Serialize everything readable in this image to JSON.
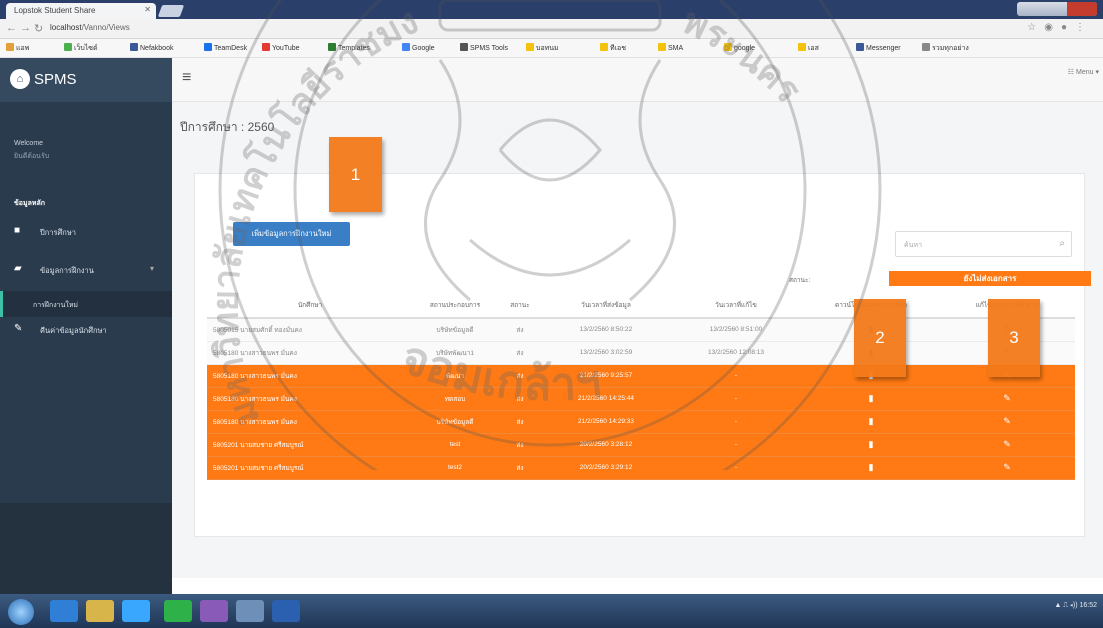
{
  "browser": {
    "tab_title": "Lopstok Student Share",
    "url_host": "localhost",
    "url_path": "/Vanno/Views",
    "bookmarks": [
      "แอพ",
      "เว็บไซต์",
      "Nefakbook",
      "TeamDesk",
      "YouTube",
      "Templates",
      "Google",
      "SPMS Tools",
      "บอทนม",
      "ทีเอช",
      "SMA",
      "google",
      "เอส",
      "Messenger",
      "รวมทุกอย่าง"
    ]
  },
  "sidebar": {
    "brand": "SPMS",
    "welcome": "Welcome",
    "welcome_user": "ยินดีต้อนรับ",
    "heading": "ข้อมูลหลัก",
    "items": [
      {
        "label": "ปีการศึกษา",
        "icon": "bookmark-icon"
      },
      {
        "label": "ข้อมูลการฝึกงาน",
        "icon": "folder-icon"
      },
      {
        "label": "การฝึกงานใหม่",
        "icon": "sub-item"
      },
      {
        "label": "คืนค่าข้อมูลนักศึกษา",
        "icon": "edit-icon"
      }
    ]
  },
  "header": {
    "menu": "Menu"
  },
  "main": {
    "year_label": "ปีการศึกษา : 2560",
    "add_button": "เพิ่มข้อมูลการฝึกงานใหม่",
    "search_placeholder": "ค้นหา",
    "legend_label": "สถานะ:",
    "legend_status": "ยังไม่ส่งเอกสาร",
    "columns": [
      "นักศึกษา",
      "สถานประกอบการ",
      "สถานะ",
      "วันเวลาที่ส่งข้อมูล",
      "วันเวลาที่แก้ไข",
      "ดาวน์โหลดเอกสารการฝึก",
      "แก้ไขข้อมูลการฝึกงาน"
    ],
    "rows": [
      {
        "student": "5805015 นายสมศักดิ์ ทองมั่นคง",
        "company": "บริษัทข้อมูลดี",
        "status": "ส่ง",
        "submitted": "13/2/2560 8:50:22",
        "edited": "13/2/2560 8:51:00",
        "highlight": false
      },
      {
        "student": "5805180 นางสาวธนพร มั่นคง",
        "company": "บริษัทพัฒนา1",
        "status": "ส่ง",
        "submitted": "13/2/2560 3:02:59",
        "edited": "13/2/2560 12:08:13",
        "highlight": false
      },
      {
        "student": "5805180 นางสาวธนพร มั่นคง",
        "company": "พัฒนา",
        "status": "ส่ง",
        "submitted": "21/2/2560 9:25:57",
        "edited": "-",
        "highlight": true
      },
      {
        "student": "5805180 นางสาวธนพร มั่นคง",
        "company": "ทดสอบ",
        "status": "ส่ง",
        "submitted": "21/2/2560 14:25:44",
        "edited": "-",
        "highlight": true
      },
      {
        "student": "5805180 นางสาวธนพร มั่นคง",
        "company": "บริษัทข้อมูลดี",
        "status": "ส่ง",
        "submitted": "21/2/2560 14:29:33",
        "edited": "-",
        "highlight": true
      },
      {
        "student": "5805201 นายสมชาย ศรีสมบูรณ์",
        "company": "test",
        "status": "ส่ง",
        "submitted": "20/2/2560 3:28:12",
        "edited": "-",
        "highlight": true
      },
      {
        "student": "5805201 นายสมชาย ศรีสมบูรณ์",
        "company": "test2",
        "status": "ส่ง",
        "submitted": "20/2/2560 3:29:12",
        "edited": "-",
        "highlight": true
      }
    ]
  },
  "callouts": [
    "1",
    "2",
    "3"
  ],
  "watermark": {
    "arc_left": "มหาวิทยาลัยเทคโนโลยีราชมงคล",
    "arc_bottom": "จอมเกล้าฯ",
    "arc_right": "พระนคร"
  },
  "taskbar": {
    "tray_time": "16:52"
  },
  "colors": {
    "highlight": "#ff7a14",
    "sidebar": "#2a3b4d",
    "primary_button": "#3a7fc6"
  }
}
